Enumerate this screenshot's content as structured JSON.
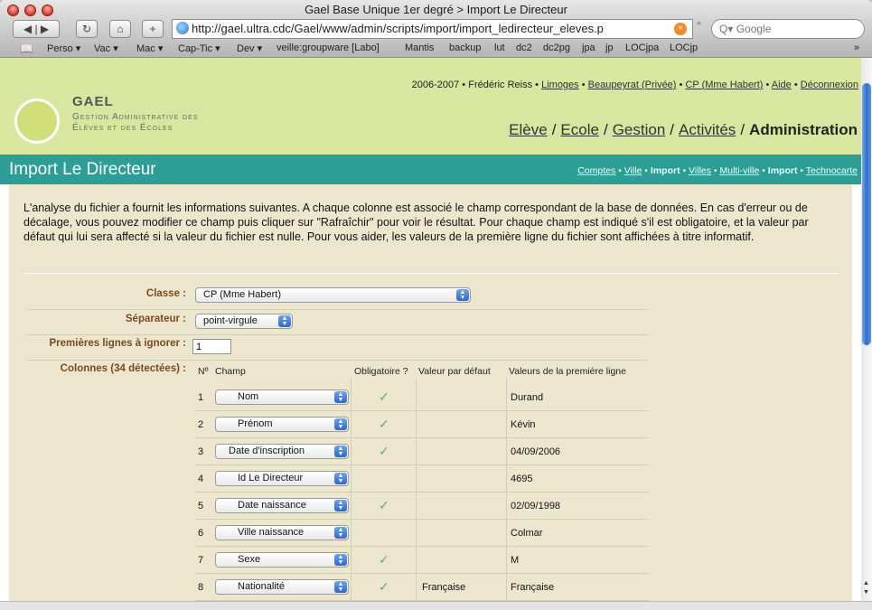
{
  "window": {
    "title": "Gael Base Unique 1er degré > Import Le Directeur",
    "url": "http://gael.ultra.cdc/Gael/www/admin/scripts/import/import_ledirecteur_eleves.p",
    "search_placeholder": "Google"
  },
  "bookmarks": [
    "Perso ▾",
    "Vac ▾",
    "Mac ▾",
    "Cap-Tic ▾",
    "Dev ▾",
    "veille:groupware [Labo]",
    "Mantis",
    "backup",
    "lut",
    "dc2",
    "dc2pg",
    "jpa",
    "jp",
    "LOCjpa",
    "LOCjp"
  ],
  "header": {
    "logo_title": "GAEL",
    "logo_line1": "Gestion Administrative des",
    "logo_line2": "Élèves et des Écoles",
    "info": {
      "year": "2006-2007",
      "user": "Frédéric Reiss",
      "city": "Limoges",
      "school": "Beaupeyrat (Privée)",
      "class": "CP (Mme Habert)",
      "help": "Aide",
      "logout": "Déconnexion"
    },
    "nav": [
      "Elève",
      "Ecole",
      "Gestion",
      "Activités",
      "Administration"
    ]
  },
  "page": {
    "title": "Import Le Directeur",
    "subnav": [
      "Comptes",
      "Ville",
      "Import",
      "Villes",
      "Multi-ville",
      "Import",
      "Technocarte"
    ]
  },
  "intro": "L'analyse du fichier a fournit les informations suivantes. A chaque colonne est associé le champ correspondant de la base de données. En cas d'erreur ou de décalage, vous pouvez modifier ce champ puis cliquer sur \"Rafraîchir\" pour voir le résultat. Pour chaque champ est indiqué s'il est obligatoire, et la valeur par défaut qui lui sera affecté si la valeur du fichier est nulle. Pour vous aider, les valeurs de la première ligne du fichier sont affichées à titre informatif.",
  "form": {
    "classe_label": "Classe :",
    "classe_value": "CP (Mme Habert)",
    "separateur_label": "Séparateur :",
    "separateur_value": "point-virgule",
    "ignore_label": "Premières lignes à ignorer :",
    "ignore_value": "1",
    "colonnes_label": "Colonnes (34 détectées) :"
  },
  "table": {
    "headers": [
      "Nº",
      "Champ",
      "Obligatoire ?",
      "Valeur par défaut",
      "Valeurs de la première ligne"
    ],
    "rows": [
      {
        "n": "1",
        "champ": "Nom",
        "obligatoire": "✓",
        "defaut": "",
        "valeur": "Durand"
      },
      {
        "n": "2",
        "champ": "Prénom",
        "obligatoire": "✓",
        "defaut": "",
        "valeur": "Kévin"
      },
      {
        "n": "3",
        "champ": "Date d'inscription",
        "obligatoire": "✓",
        "defaut": "",
        "valeur": "04/09/2006"
      },
      {
        "n": "4",
        "champ": "Id Le Directeur",
        "obligatoire": "",
        "defaut": "",
        "valeur": "4695"
      },
      {
        "n": "5",
        "champ": "Date naissance",
        "obligatoire": "✓",
        "defaut": "",
        "valeur": "02/09/1998"
      },
      {
        "n": "6",
        "champ": "Ville naissance",
        "obligatoire": "",
        "defaut": "",
        "valeur": "Colmar"
      },
      {
        "n": "7",
        "champ": "Sexe",
        "obligatoire": "✓",
        "defaut": "",
        "valeur": "M"
      },
      {
        "n": "8",
        "champ": "Nationalité",
        "obligatoire": "✓",
        "defaut": "Française",
        "valeur": "Française"
      }
    ]
  }
}
